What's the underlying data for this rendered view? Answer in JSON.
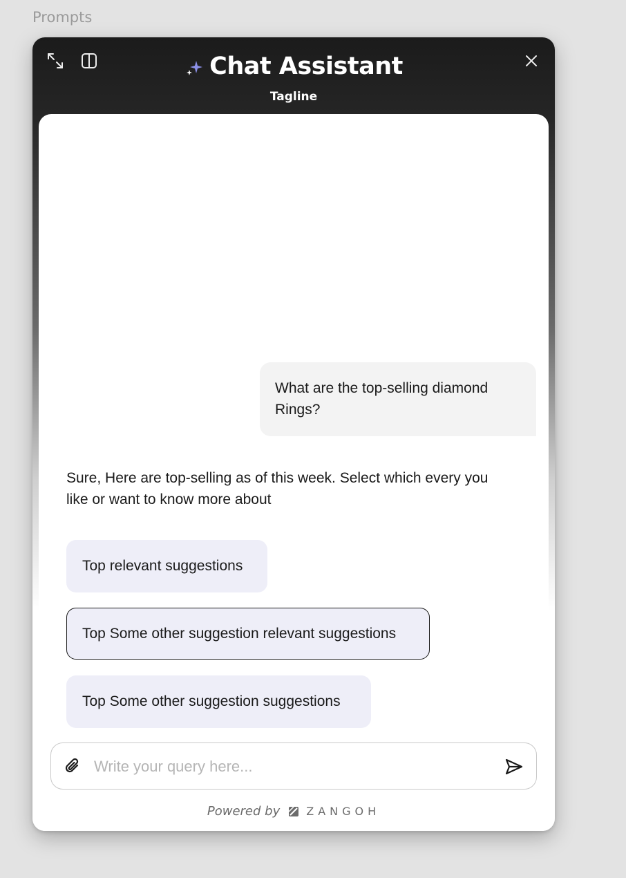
{
  "frame": {
    "label": "Prompts"
  },
  "header": {
    "title": "Chat Assistant",
    "tagline": "Tagline",
    "expand_icon": "expand-arrows-icon",
    "split_icon": "split-panel-icon",
    "close_icon": "close-icon",
    "sparkle_icon": "sparkle-icon",
    "sparkle_color": "#8b8fe6"
  },
  "conversation": {
    "user_message": "What are the top-selling diamond Rings?",
    "assistant_message": "Sure, Here are top-selling as of this week. Select which every you like or want to know more about",
    "suggestions": [
      {
        "label": "Top relevant suggestions",
        "selected": false
      },
      {
        "label": "Top Some other suggestion relevant suggestions",
        "selected": true
      },
      {
        "label": "Top Some other suggestion suggestions",
        "selected": false
      }
    ],
    "suggestion_bg": "#eeeef8"
  },
  "composer": {
    "placeholder": "Write your query here...",
    "value": "",
    "attach_icon": "paperclip-icon",
    "send_icon": "send-icon"
  },
  "footer": {
    "powered_by": "Powered by",
    "brand": "ZANGOH"
  }
}
